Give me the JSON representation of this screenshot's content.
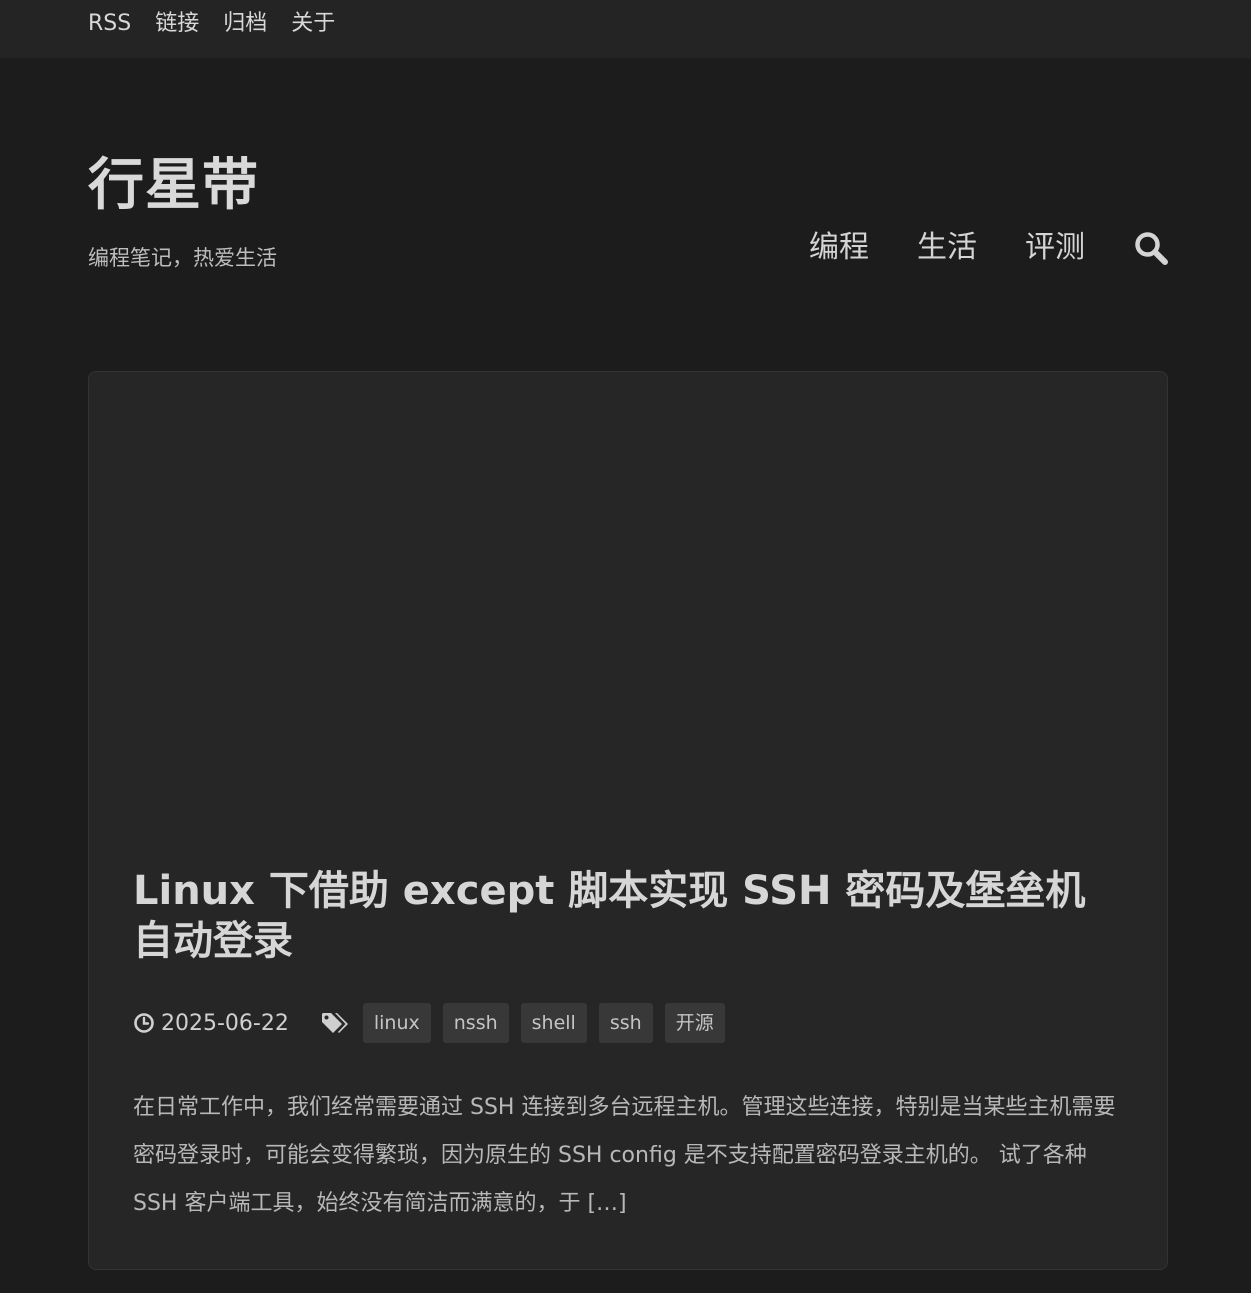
{
  "topbar": {
    "links": [
      "RSS",
      "链接",
      "归档",
      "关于"
    ]
  },
  "site": {
    "title": "行星带",
    "subtitle": "编程笔记，热爱生活"
  },
  "nav": {
    "items": [
      "编程",
      "生活",
      "评测"
    ],
    "search_icon": "search-icon"
  },
  "post": {
    "title": "Linux 下借助 except 脚本实现 SSH 密码及堡垒机自动登录",
    "date": "2025-06-22",
    "date_icon": "clock-icon",
    "tags_icon": "tags-icon",
    "tags": [
      "linux",
      "nssh",
      "shell",
      "ssh",
      "开源"
    ],
    "excerpt": "在日常工作中，我们经常需要通过 SSH 连接到多台远程主机。管理这些连接，特别是当某些主机需要密码登录时，可能会变得繁琐，因为原生的 SSH config 是不支持配置密码登录主机的。 试了各种 SSH 客户端工具，始终没有简洁而满意的，于 […]"
  },
  "colors": {
    "page_bg": "#1c1c1c",
    "topbar_bg": "#242424",
    "card_bg": "#262626",
    "tag_bg": "#383838"
  }
}
